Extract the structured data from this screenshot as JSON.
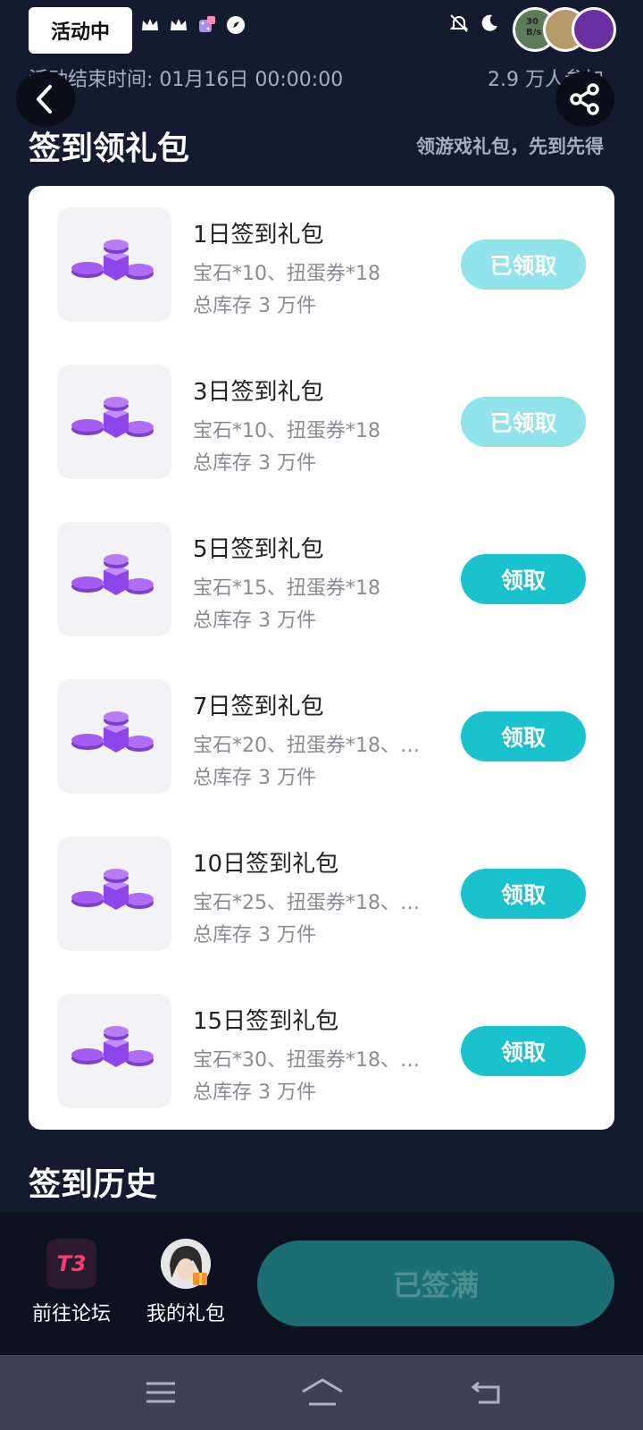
{
  "status_bar": {
    "event_tag": "活动中",
    "speed": "30\nB/s"
  },
  "event": {
    "end_time_label": "活动结束时间: 01月16日 00:00:00",
    "participants": "2.9 万人参加"
  },
  "section": {
    "title": "签到领礼包",
    "subtitle": "领游戏礼包，先到先得"
  },
  "gifts": [
    {
      "name": "1日签到礼包",
      "items": "宝石*10、扭蛋券*18",
      "stock": "总库存 3 万件",
      "button": "已领取",
      "claimed": true
    },
    {
      "name": "3日签到礼包",
      "items": "宝石*10、扭蛋券*18",
      "stock": "总库存 3 万件",
      "button": "已领取",
      "claimed": true
    },
    {
      "name": "5日签到礼包",
      "items": "宝石*15、扭蛋券*18",
      "stock": "总库存 3 万件",
      "button": "领取",
      "claimed": false
    },
    {
      "name": "7日签到礼包",
      "items": "宝石*20、扭蛋券*18、…",
      "stock": "总库存 3 万件",
      "button": "领取",
      "claimed": false
    },
    {
      "name": "10日签到礼包",
      "items": "宝石*25、扭蛋券*18、…",
      "stock": "总库存 3 万件",
      "button": "领取",
      "claimed": false
    },
    {
      "name": "15日签到礼包",
      "items": "宝石*30、扭蛋券*18、…",
      "stock": "总库存 3 万件",
      "button": "领取",
      "claimed": false
    }
  ],
  "history": {
    "title": "签到历史"
  },
  "action_bar": {
    "forum_logo": "T3",
    "forum_label": "前往论坛",
    "my_gifts_label": "我的礼包",
    "signed_button": "已签满"
  },
  "colors": {
    "background": "#141a30",
    "accent": "#19c2cc",
    "claimed": "#8fe3e9",
    "signed_full": "#1b6f72"
  },
  "icons": [
    "crown-icon",
    "dice-icon",
    "compass-icon",
    "bell-off-icon",
    "moon-icon",
    "back-arrow-icon",
    "share-icon",
    "gem-pile-icon",
    "menu-icon",
    "home-icon",
    "return-icon"
  ]
}
